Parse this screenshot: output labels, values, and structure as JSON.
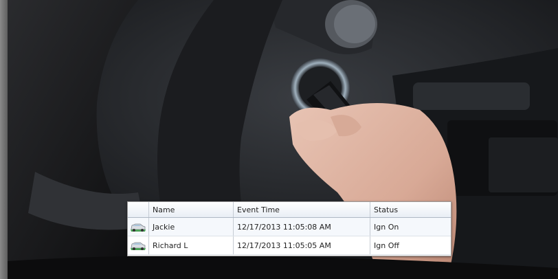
{
  "grid": {
    "columns": [
      "Name",
      "Event Time",
      "Status"
    ],
    "rows": [
      {
        "icon": "vehicle-icon",
        "name": "Jackie",
        "event_time": "12/17/2013 11:05:08 AM",
        "status": "Ign On"
      },
      {
        "icon": "vehicle-icon",
        "name": "Richard L",
        "event_time": "12/17/2013 11:05:05 AM",
        "status": "Ign Off"
      }
    ]
  },
  "colors": {
    "vehicle_icon_green": "#4ea35a",
    "vehicle_icon_silver": "#d9dde2"
  }
}
